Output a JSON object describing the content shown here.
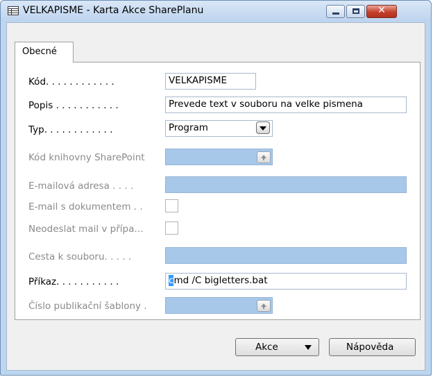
{
  "window": {
    "title": "VELKAPISME - Karta Akce SharePlanu",
    "close_glyph": "✕"
  },
  "tabs": [
    {
      "label": "Obecné"
    }
  ],
  "fields": {
    "kod": {
      "label": "Kód. . . . . . . . . . . .",
      "value": "VELKAPISME"
    },
    "popis": {
      "label": "Popis . . . . . . . . . . .",
      "value": "Prevede text v souboru na velke pismena"
    },
    "typ": {
      "label": "Typ. . . . . . . . . . . .",
      "value": "Program"
    },
    "kod_knihovny": {
      "label": "Kód knihovny SharePoint",
      "value": ""
    },
    "email": {
      "label": "E-mailová adresa . . . .",
      "value": ""
    },
    "email_dokument": {
      "label": "E-mail s dokumentem . .",
      "checked": false
    },
    "neodeslat": {
      "label": "Neodeslat mail v přípa…",
      "checked": false
    },
    "cesta": {
      "label": "Cesta k souboru. . . . .",
      "value": ""
    },
    "prikaz": {
      "label": "Příkaz. . . . . . . . . . .",
      "value_first_char": "c",
      "value_rest": "md /C bigletters.bat"
    },
    "cislo_sablony": {
      "label": "Číslo publikační šablony .",
      "value": ""
    }
  },
  "buttons": {
    "akce": "Akce",
    "napoveda": "Nápověda"
  }
}
